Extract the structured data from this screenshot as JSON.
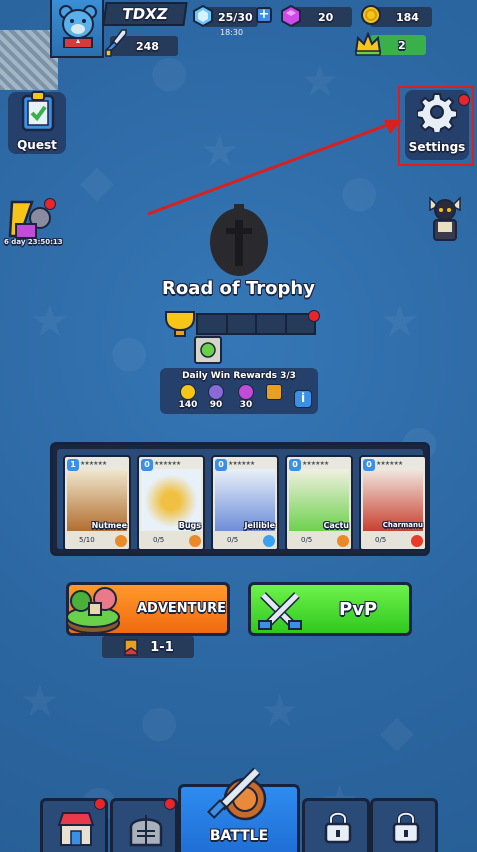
{
  "player": {
    "name": "TDXZ",
    "power": "248"
  },
  "resources": {
    "energy": "25/30",
    "energy_timer": "18:30",
    "gems": "20",
    "coins": "184",
    "crowns": "2"
  },
  "side_buttons": {
    "quest_label": "Quest",
    "settings_label": "Settings",
    "event_timer": "6 day 23:50:13"
  },
  "road": {
    "title": "Road of Trophy",
    "daily_title": "Daily Win Rewards 3/3",
    "rewards": [
      {
        "icon": "coin-icon",
        "value": "140",
        "color": "#f5c518"
      },
      {
        "icon": "power-icon",
        "value": "90",
        "color": "#8a6ad6"
      },
      {
        "icon": "star-icon",
        "value": "30",
        "color": "#c04cd8"
      },
      {
        "icon": "chest-icon",
        "value": "",
        "color": "#e8a020"
      }
    ]
  },
  "deck": [
    {
      "level": "1",
      "name": "Nutmee",
      "progress": "5/10",
      "element_color": "#e88a2a",
      "art": "#b06a2a"
    },
    {
      "level": "0",
      "name": "Bugs",
      "progress": "0/5",
      "element_color": "#e88a2a",
      "art": "#f0c040"
    },
    {
      "level": "0",
      "name": "Jellible",
      "progress": "0/5",
      "element_color": "#3aa0f0",
      "art": "#6a8ad8"
    },
    {
      "level": "0",
      "name": "Cactu",
      "progress": "0/5",
      "element_color": "#e88a2a",
      "art": "#6ad04a"
    },
    {
      "level": "0",
      "name": "Charmanu",
      "progress": "0/5",
      "element_color": "#e83a2a",
      "art": "#c83a2a"
    }
  ],
  "modes": {
    "adventure_label": "ADVENTURE",
    "stage": "1-1",
    "pvp_label": "PvP"
  },
  "nav": {
    "battle_label": "BATTLE"
  },
  "colors": {
    "background": "#2e6aa6",
    "panel": "#263a5a",
    "highlight": "#e21b1b",
    "notification": "#e8262a",
    "adventure": "#f57a18",
    "pvp": "#4ada30",
    "battle": "#2a80e6"
  }
}
